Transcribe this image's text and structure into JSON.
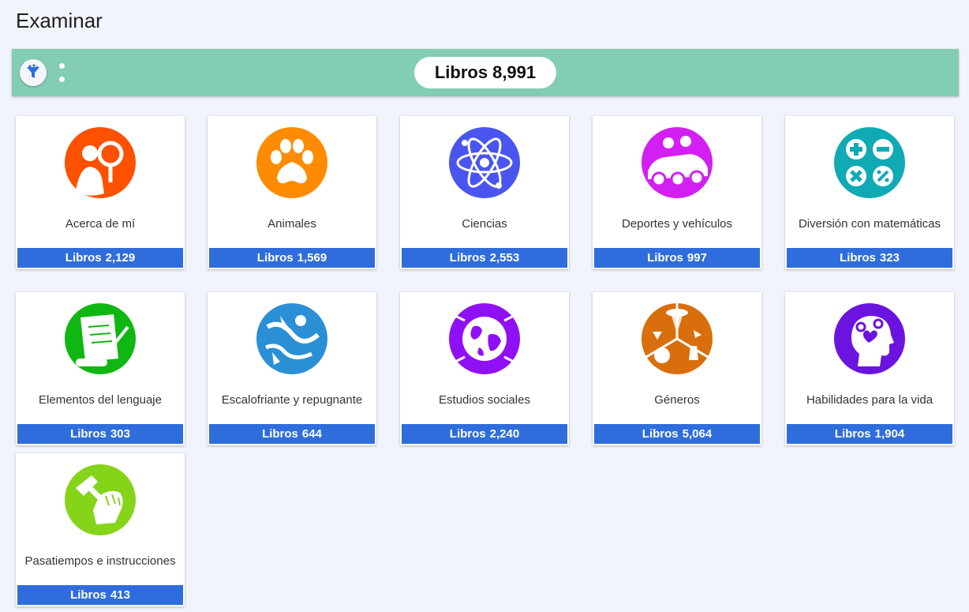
{
  "page": {
    "title": "Examinar"
  },
  "toolbar": {
    "total_label": "Libros",
    "total_count": "8,991",
    "accent_color": "#82cdb3"
  },
  "categories": [
    {
      "label": "Acerca de mí",
      "count_label": "Libros",
      "count": "2,129",
      "icon": "person-magnifier-icon",
      "color": "#fe5100"
    },
    {
      "label": "Animales",
      "count_label": "Libros",
      "count": "1,569",
      "icon": "paw-icon",
      "color": "#ff8c00"
    },
    {
      "label": "Ciencias",
      "count_label": "Libros",
      "count": "2,553",
      "icon": "atom-icon",
      "color": "#4a55f0"
    },
    {
      "label": "Deportes y vehículos",
      "count_label": "Libros",
      "count": "997",
      "icon": "race-car-icon",
      "color": "#d21ff2"
    },
    {
      "label": "Diversión con matemáticas",
      "count_label": "Libros",
      "count": "323",
      "icon": "math-operators-icon",
      "color": "#10aab5"
    },
    {
      "label": "Elementos del lenguaje",
      "count_label": "Libros",
      "count": "303",
      "icon": "scroll-quill-icon",
      "color": "#10b611"
    },
    {
      "label": "Escalofriante y repugnante",
      "count_label": "Libros",
      "count": "644",
      "icon": "creepy-figure-icon",
      "color": "#2b8fd6"
    },
    {
      "label": "Estudios sociales",
      "count_label": "Libros",
      "count": "2,240",
      "icon": "globe-icon",
      "color": "#9010f6"
    },
    {
      "label": "Géneros",
      "count_label": "Libros",
      "count": "5,064",
      "icon": "genres-icon",
      "color": "#d96e0d"
    },
    {
      "label": "Habilidades para la vida",
      "count_label": "Libros",
      "count": "1,904",
      "icon": "head-heart-gears-icon",
      "color": "#6b14e0"
    },
    {
      "label": "Pasatiempos e instrucciones",
      "count_label": "Libros",
      "count": "413",
      "icon": "hammer-fist-icon",
      "color": "#86d41a"
    }
  ]
}
